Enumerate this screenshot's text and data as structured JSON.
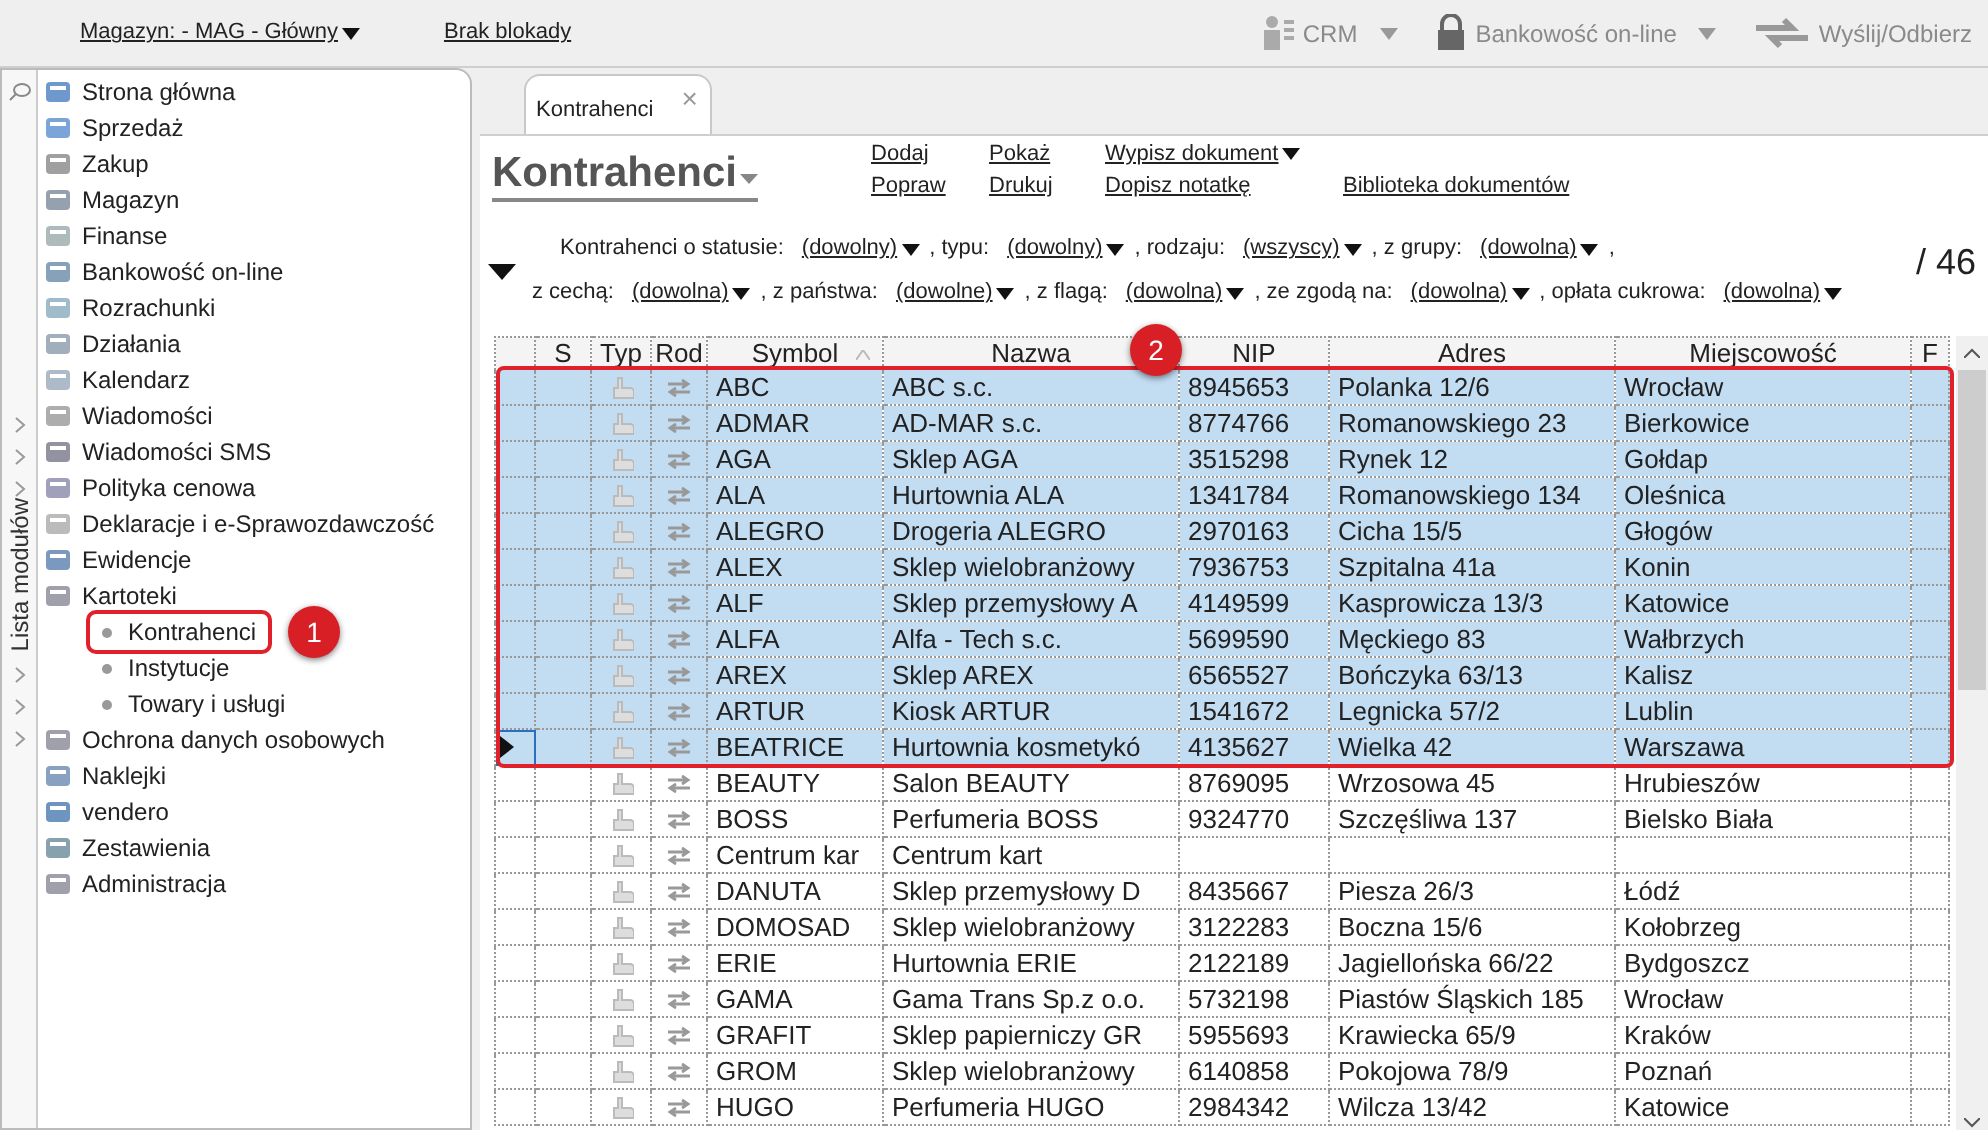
{
  "toolbar": {
    "warehouse": "Magazyn: - MAG - Główny",
    "lock": "Brak blokady",
    "buttons": [
      {
        "label": "CRM",
        "disabled": true,
        "dropdown": true,
        "kind": "crm"
      },
      {
        "label": "Bankowość on-line",
        "disabled": true,
        "dropdown": true,
        "kind": "bank"
      },
      {
        "label": "Wyślij/Odbierz",
        "disabled": true,
        "dropdown": false,
        "kind": "send"
      }
    ]
  },
  "sidebar": {
    "title": "Lista modułów",
    "items": [
      {
        "label": "Strona główna"
      },
      {
        "label": "Sprzedaż"
      },
      {
        "label": "Zakup"
      },
      {
        "label": "Magazyn"
      },
      {
        "label": "Finanse"
      },
      {
        "label": "Bankowość on-line"
      },
      {
        "label": "Rozrachunki"
      },
      {
        "label": "Działania"
      },
      {
        "label": "Kalendarz"
      },
      {
        "label": "Wiadomości"
      },
      {
        "label": "Wiadomości SMS"
      },
      {
        "label": "Polityka cenowa"
      },
      {
        "label": "Deklaracje i e-Sprawozdawczość"
      },
      {
        "label": "Ewidencje"
      },
      {
        "label": "Kartoteki",
        "expanded": true,
        "children": [
          {
            "label": "Kontrahenci",
            "callout": "1"
          },
          {
            "label": "Instytucje"
          },
          {
            "label": "Towary i usługi"
          }
        ]
      },
      {
        "label": "Ochrona danych osobowych"
      },
      {
        "label": "Naklejki"
      },
      {
        "label": "vendero"
      },
      {
        "label": "Zestawienia"
      },
      {
        "label": "Administracja"
      }
    ]
  },
  "tab": {
    "label": "Kontrahenci",
    "close": "×"
  },
  "heading": "Kontrahenci",
  "actions": [
    [
      {
        "label": "Dodaj",
        "dropdown": false
      },
      {
        "label": "Pokaż",
        "dropdown": false
      },
      {
        "label": "Wypisz dokument",
        "dropdown": true
      }
    ],
    [
      {
        "label": "Popraw",
        "dropdown": false
      },
      {
        "label": "Drukuj",
        "dropdown": false
      },
      {
        "label": "Dopisz notatkę",
        "dropdown": false
      },
      {
        "label": "Biblioteka dokumentów",
        "dropdown": false
      }
    ]
  ],
  "filters": [
    [
      {
        "kind": "label",
        "text": "Kontrahenci o statusie:"
      },
      {
        "kind": "dropdown",
        "text": "(dowolny)"
      },
      {
        "kind": "label",
        "text": ", typu:"
      },
      {
        "kind": "dropdown",
        "text": "(dowolny)"
      },
      {
        "kind": "label",
        "text": ", rodzaju:"
      },
      {
        "kind": "dropdown",
        "text": "(wszyscy)"
      },
      {
        "kind": "label",
        "text": ", z grupy:"
      },
      {
        "kind": "dropdown",
        "text": "(dowolna)"
      },
      {
        "kind": "label",
        "text": ","
      }
    ],
    [
      {
        "kind": "label",
        "text": "z cechą:"
      },
      {
        "kind": "dropdown",
        "text": "(dowolna)"
      },
      {
        "kind": "label",
        "text": ", z państwa:"
      },
      {
        "kind": "dropdown",
        "text": "(dowolne)"
      },
      {
        "kind": "label",
        "text": ", z flagą:"
      },
      {
        "kind": "dropdown",
        "text": "(dowolna)"
      },
      {
        "kind": "label",
        "text": ", ze zgodą na:"
      },
      {
        "kind": "dropdown",
        "text": "(dowolna)"
      },
      {
        "kind": "label",
        "text": ", opłata cukrowa:"
      },
      {
        "kind": "dropdown",
        "text": "(dowolna)"
      }
    ]
  ],
  "count": "/ 46",
  "table": {
    "callout": "2",
    "columns": [
      "S",
      "Typ",
      "Rod",
      "Symbol",
      "Nazwa",
      "NIP",
      "Adres",
      "Miejscowość",
      "F"
    ],
    "rows": [
      {
        "symbol": "ABC",
        "name": "ABC s.c.",
        "nip": "8945653",
        "address": "Polanka  12/6",
        "city": "Wrocław",
        "selected": true,
        "current": false
      },
      {
        "symbol": "ADMAR",
        "name": "AD-MAR s.c.",
        "nip": "8774766",
        "address": "Romanowskiego 23",
        "city": "Bierkowice",
        "selected": true,
        "current": false
      },
      {
        "symbol": "AGA",
        "name": "Sklep AGA",
        "nip": "3515298",
        "address": "Rynek 12",
        "city": "Gołdap",
        "selected": true,
        "current": false
      },
      {
        "symbol": "ALA",
        "name": "Hurtownia ALA",
        "nip": "1341784",
        "address": "Romanowskiego 134",
        "city": "Oleśnica",
        "selected": true,
        "current": false
      },
      {
        "symbol": "ALEGRO",
        "name": "Drogeria ALEGRO",
        "nip": "2970163",
        "address": "Cicha  15/5",
        "city": "Głogów",
        "selected": true,
        "current": false
      },
      {
        "symbol": "ALEX",
        "name": "Sklep wielobranżowy",
        "nip": "7936753",
        "address": "Szpitalna  41a",
        "city": "Konin",
        "selected": true,
        "current": false
      },
      {
        "symbol": "ALF",
        "name": "Sklep przemysłowy A",
        "nip": "4149599",
        "address": "Kasprowicza  13/3",
        "city": "Katowice",
        "selected": true,
        "current": false
      },
      {
        "symbol": "ALFA",
        "name": "Alfa - Tech s.c.",
        "nip": "5699590",
        "address": "Męckiego  83",
        "city": "Wałbrzych",
        "selected": true,
        "current": false
      },
      {
        "symbol": "AREX",
        "name": "Sklep AREX",
        "nip": "6565527",
        "address": "Bończyka  63/13",
        "city": "Kalisz",
        "selected": true,
        "current": false
      },
      {
        "symbol": "ARTUR",
        "name": "Kiosk ARTUR",
        "nip": "1541672",
        "address": "Legnicka  57/2",
        "city": "Lublin",
        "selected": true,
        "current": false
      },
      {
        "symbol": "BEATRICE",
        "name": "Hurtownia kosmetykó",
        "nip": "4135627",
        "address": "Wielka  42",
        "city": "Warszawa",
        "selected": true,
        "current": true
      },
      {
        "symbol": "BEAUTY",
        "name": "Salon BEAUTY",
        "nip": "8769095",
        "address": "Wrzosowa  45",
        "city": "Hrubieszów",
        "selected": false,
        "current": false
      },
      {
        "symbol": "BOSS",
        "name": "Perfumeria BOSS",
        "nip": "9324770",
        "address": "Szczęśliwa  137",
        "city": "Bielsko Biała",
        "selected": false,
        "current": false
      },
      {
        "symbol": "Centrum kar",
        "name": "Centrum kart",
        "selected": false,
        "current": false
      },
      {
        "symbol": "DANUTA",
        "name": "Sklep przemysłowy D",
        "nip": "8435667",
        "address": "Piesza  26/3",
        "city": "Łódź",
        "selected": false,
        "current": false
      },
      {
        "symbol": "DOMOSAD",
        "name": "Sklep wielobranżowy",
        "nip": "3122283",
        "address": "Boczna  15/6",
        "city": "Kołobrzeg",
        "selected": false,
        "current": false
      },
      {
        "symbol": "ERIE",
        "name": "Hurtownia ERIE",
        "nip": "2122189",
        "address": "Jagiellońska  66/22",
        "city": "Bydgoszcz",
        "selected": false,
        "current": false
      },
      {
        "symbol": "GAMA",
        "name": "Gama Trans Sp.z o.o.",
        "nip": "5732198",
        "address": "Piastów Śląskich 185",
        "city": "Wrocław",
        "selected": false,
        "current": false
      },
      {
        "symbol": "GRAFIT",
        "name": "Sklep papierniczy GR",
        "nip": "5955693",
        "address": "Krawiecka  65/9",
        "city": "Kraków",
        "selected": false,
        "current": false
      },
      {
        "symbol": "GROM",
        "name": "Sklep wielobranżowy",
        "nip": "6140858",
        "address": "Pokojowa  78/9",
        "city": "Poznań",
        "selected": false,
        "current": false
      },
      {
        "symbol": "HUGO",
        "name": "Perfumeria HUGO",
        "nip": "2984342",
        "address": "Wilcza  13/42",
        "city": "Katowice",
        "selected": false,
        "current": false
      }
    ]
  }
}
